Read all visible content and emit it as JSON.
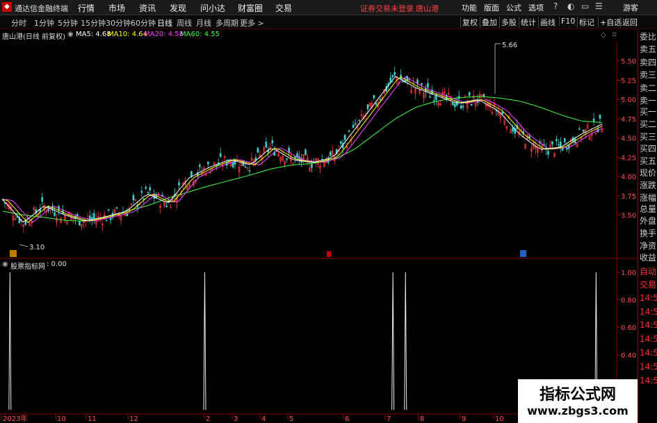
{
  "titlebar": {
    "app_title": "通达信金融终端",
    "menus": [
      "行情",
      "市场",
      "资讯",
      "发现",
      "问小达",
      "财富圈",
      "交易"
    ],
    "status": "证券交易未登录",
    "stock": "唐山港",
    "right_menus": [
      "功能",
      "版面",
      "公式",
      "选项"
    ],
    "user": "游客"
  },
  "toolbar": {
    "periods": [
      "分时",
      "1分钟",
      "5分钟",
      "15分钟",
      "30分钟",
      "60分钟",
      "日线",
      "周线",
      "月线",
      "多周期",
      "更多 >"
    ],
    "active_period": "日线",
    "right_buttons": [
      "复权",
      "叠加",
      "多股",
      "统计",
      "画线",
      "F10",
      "标记",
      "+自选",
      "返回"
    ]
  },
  "main_chart": {
    "name": "唐山港(日线 前复权)",
    "indicators": [
      {
        "label": "MA5: 4.68",
        "color": "#ffffff"
      },
      {
        "label": "MA10: 4.64",
        "color": "#ffff00"
      },
      {
        "label": "MA20: 4.58",
        "color": "#ff40ff"
      },
      {
        "label": "MA60: 4.55",
        "color": "#40ff40"
      }
    ],
    "price_axis": [
      "5.50",
      "5.25",
      "5.00",
      "4.75",
      "4.50",
      "4.25",
      "4.00",
      "3.75",
      "3.50"
    ],
    "high_label": "5.66",
    "low_label": "3.10"
  },
  "sub_chart": {
    "name": "股票指标网",
    "value": ": 0.00",
    "axis": [
      "1.00",
      "0.80",
      "0.60",
      "0.40",
      "0.20"
    ]
  },
  "date_axis": [
    "2023年",
    "10",
    "11",
    "12",
    "2",
    "3",
    "4",
    "5",
    "6",
    "7",
    "8",
    "9",
    "10"
  ],
  "side_panel": {
    "items": [
      "委比",
      "卖五",
      "卖四",
      "卖三",
      "卖二",
      "卖一",
      "买一",
      "买二",
      "买三",
      "买四",
      "买五",
      "现价",
      "涨跌",
      "涨幅",
      "总量",
      "外盘",
      "换手",
      "净资",
      "收益",
      "自动",
      "交易",
      "14:50",
      "14:50",
      "14:50",
      "14:50",
      "14:50",
      "14:50",
      "14:50"
    ]
  },
  "chart_data": {
    "type": "line",
    "title": "唐山港(日线 前复权)",
    "ylim": [
      3.0,
      5.75
    ],
    "dates": [
      "2023年",
      "10",
      "11",
      "12",
      "2",
      "3",
      "4",
      "5",
      "6",
      "7",
      "8",
      "9",
      "10"
    ],
    "series": [
      {
        "name": "MA60",
        "color": "#40ff40",
        "values": [
          3.55,
          3.5,
          3.47,
          3.43,
          3.42,
          3.48,
          3.55,
          3.62,
          3.72,
          3.8,
          3.88,
          3.95,
          4.02,
          4.1,
          4.15,
          4.17,
          4.22,
          4.35,
          4.55,
          4.75,
          4.9,
          4.98,
          5.02,
          5.04,
          5.02,
          4.98,
          4.9,
          4.8,
          4.72,
          4.7
        ]
      },
      {
        "name": "MA5",
        "color": "#ffffff",
        "values": [
          3.7,
          3.4,
          3.62,
          3.5,
          3.42,
          3.48,
          3.55,
          3.78,
          3.65,
          3.98,
          4.12,
          4.22,
          4.15,
          4.38,
          4.22,
          4.18,
          4.25,
          4.6,
          4.95,
          5.3,
          5.15,
          5.05,
          4.95,
          5.0,
          4.85,
          4.55,
          4.35,
          4.38,
          4.55,
          4.68
        ]
      }
    ],
    "sub_indicator": {
      "name": "股票指标网",
      "value": 0.0,
      "signal_positions": [
        0.012,
        0.337,
        0.651,
        0.672,
        0.99
      ]
    }
  }
}
